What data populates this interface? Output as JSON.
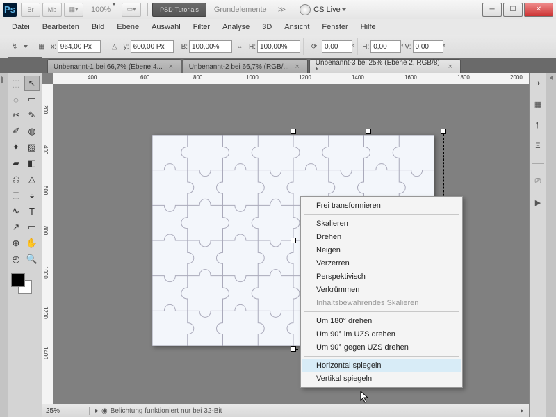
{
  "titlebar": {
    "app_logo": "Ps",
    "mini_buttons": [
      "Br",
      "Mb"
    ],
    "launcher_icon": "▦▾",
    "zoom_dropdown": "100%",
    "view_mode_icon": "▭▾",
    "psd_tutorials": "PSD-Tutorials",
    "grundelemente": "Grundelemente",
    "expand": "≫",
    "cs_live": "CS Live"
  },
  "menubar": [
    "Datei",
    "Bearbeiten",
    "Bild",
    "Ebene",
    "Auswahl",
    "Filter",
    "Analyse",
    "3D",
    "Ansicht",
    "Fenster",
    "Hilfe"
  ],
  "options": {
    "x_label": "x:",
    "x_value": "964,00 Px",
    "y_label": "y:",
    "y_value": "600,00 Px",
    "w_label": "B:",
    "w_value": "100,00%",
    "link_icon": "⇔",
    "h_label": "H:",
    "h_value": "100,00%",
    "angle_label": "⟳",
    "angle_value": "0,00",
    "hskew_label": "H:",
    "hskew_value": "0,00",
    "vskew_label": "V:",
    "vskew_value": "0,00"
  },
  "tabs": [
    {
      "label": "Unbenannt-1 bei 66,7% (Ebene 4...",
      "active": false
    },
    {
      "label": "Unbenannt-2 bei 66,7% (RGB/...",
      "active": false
    },
    {
      "label": "Unbenannt-3 bei 25% (Ebene 2, RGB/8) *",
      "active": true
    }
  ],
  "ruler_h": [
    "400",
    "600",
    "800",
    "1000",
    "1200",
    "1400",
    "1600",
    "1800",
    "2000"
  ],
  "ruler_v": [
    "200",
    "400",
    "600",
    "800",
    "1000",
    "1200",
    "1400"
  ],
  "status": {
    "zoom": "25%",
    "message": "Belichtung funktioniert nur bei 32-Bit"
  },
  "context_menu": [
    {
      "label": "Frei transformieren",
      "type": "item"
    },
    {
      "type": "sep"
    },
    {
      "label": "Skalieren",
      "type": "item"
    },
    {
      "label": "Drehen",
      "type": "item"
    },
    {
      "label": "Neigen",
      "type": "item"
    },
    {
      "label": "Verzerren",
      "type": "item"
    },
    {
      "label": "Perspektivisch",
      "type": "item"
    },
    {
      "label": "Verkrümmen",
      "type": "item"
    },
    {
      "label": "Inhaltsbewahrendes Skalieren",
      "type": "item",
      "disabled": true
    },
    {
      "type": "sep"
    },
    {
      "label": "Um 180° drehen",
      "type": "item"
    },
    {
      "label": "Um 90° im UZS drehen",
      "type": "item"
    },
    {
      "label": "Um 90° gegen UZS drehen",
      "type": "item"
    },
    {
      "type": "sep"
    },
    {
      "label": "Horizontal spiegeln",
      "type": "item",
      "highlight": true
    },
    {
      "label": "Vertikal spiegeln",
      "type": "item"
    }
  ],
  "tools": [
    [
      "⬚",
      "↖"
    ],
    [
      "◌",
      "▭"
    ],
    [
      "✂",
      "✎"
    ],
    [
      "✐",
      "◍"
    ],
    [
      "✦",
      "▨"
    ],
    [
      "▰",
      "◧"
    ],
    [
      "⎌",
      "△"
    ],
    [
      "▢",
      "◒"
    ],
    [
      "∿",
      "T"
    ],
    [
      "↗",
      "▭"
    ],
    [
      "⊕",
      "✋"
    ],
    [
      "◴",
      "🔍"
    ]
  ],
  "right_icons": [
    "◑",
    "▦",
    "¶",
    "Ξ",
    "⎚",
    "▶"
  ]
}
